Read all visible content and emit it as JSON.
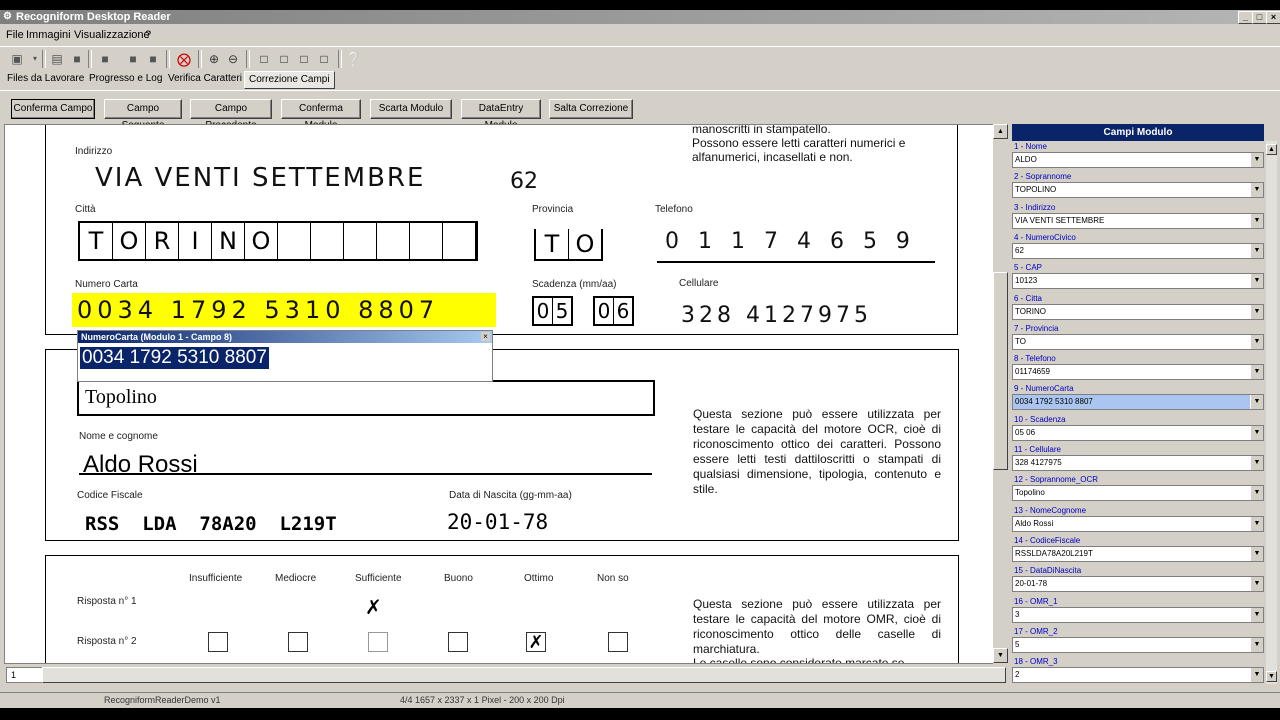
{
  "window": {
    "title": "Recogniform Desktop Reader",
    "buttons": [
      "_",
      "□",
      "×"
    ]
  },
  "menu": [
    "File",
    "Immagini",
    "Visualizzazione",
    "?"
  ],
  "tabs": [
    {
      "label": "Files da Lavorare"
    },
    {
      "label": "Progresso e Log"
    },
    {
      "label": "Verifica Caratteri"
    },
    {
      "label": "Correzione Campi"
    }
  ],
  "actions": [
    "Conferma Campo",
    "Campo Seguente",
    "Campo Precedente",
    "Conferma Modulo",
    "Scarta Modulo",
    "DataEntry Modulo",
    "Salta Correzione"
  ],
  "document": {
    "top_text_line1": "manoscritti in stampatello.",
    "top_text_line2": "Possono essere letti caratteri numerici e",
    "top_text_line3": "alfanumerici, incasellati e non.",
    "label_indirizzo": "Indirizzo",
    "hw_indirizzo": "VIA  VENTI  SETTEMBRE",
    "hw_civico": "62",
    "label_citta": "Città",
    "citta_boxes": [
      "T",
      "O",
      "R",
      "I",
      "N",
      "O",
      "",
      "",
      "",
      "",
      "",
      "",
      ""
    ],
    "label_provincia": "Provincia",
    "provincia_boxes": [
      "T",
      "O"
    ],
    "label_telefono": "Telefono",
    "hw_telefono": "0 1 1 7 4 6 5 9",
    "label_numero_carta": "Numero Carta",
    "hw_numero_carta": "0034  1792  5310  8807",
    "label_scadenza": "Scadenza (mm/aa)",
    "scadenza_boxes": [
      "0",
      "5",
      "0",
      "6"
    ],
    "label_cellulare": "Cellulare",
    "hw_cellulare": "328   4127975",
    "popup_caption": "NumeroCarta (Modulo 1 - Campo 8)",
    "popup_value": "0034 1792 5310 8807",
    "typed_soprannome": "Topolino",
    "label_nome": "Nome e cognome",
    "typed_nome": "Aldo Rossi",
    "label_cf": "Codice Fiscale",
    "typed_cf": "RSS  LDA  78A20  L219T",
    "label_nascita": "Data di Nascita (gg-mm-aa)",
    "typed_nascita": "20-01-78",
    "ocr_text": "Questa sezione può essere utilizzata per testare le capacità del motore OCR, cioè di riconoscimento ottico dei caratteri. Possono essere letti testi dattiloscritti o stampati di qualsiasi dimensione, tipologia, contenuto e stile.",
    "omr_headers": [
      "Insufficiente",
      "Mediocre",
      "Sufficiente",
      "Buono",
      "Ottimo",
      "Non so"
    ],
    "risposta1": "Risposta n° 1",
    "risposta2": "Risposta n° 2",
    "omr_text": "Questa sezione può essere utilizzata per testare le capacità del motore OMR, cioè di riconoscimento ottico delle caselle di marchiatura.",
    "omr_text_cut": "Le caselle sono considerate marcate se"
  },
  "panel": {
    "title": "Campi Modulo",
    "fields": [
      {
        "label": "1 - Nome",
        "value": "ALDO"
      },
      {
        "label": "2 - Soprannome",
        "value": "TOPOLINO"
      },
      {
        "label": "3 - Indirizzo",
        "value": "VIA VENTI SETTEMBRE"
      },
      {
        "label": "4 - NumeroCivico",
        "value": "62"
      },
      {
        "label": "5 - CAP",
        "value": "10123"
      },
      {
        "label": "6 - Citta",
        "value": "TORINO"
      },
      {
        "label": "7 - Provincia",
        "value": "TO"
      },
      {
        "label": "8 - Telefono",
        "value": "01174659"
      },
      {
        "label": "9 - NumeroCarta",
        "value": "0034 1792 5310 8807"
      },
      {
        "label": "10 - Scadenza",
        "value": "05 06"
      },
      {
        "label": "11 - Cellulare",
        "value": "328 4127975"
      },
      {
        "label": "12 - Soprannome_OCR",
        "value": "Topolino"
      },
      {
        "label": "13 - NomeCognome",
        "value": "Aldo Rossi"
      },
      {
        "label": "14 - CodiceFiscale",
        "value": "RSSLDA78A20L219T"
      },
      {
        "label": "15 - DataDiNascita",
        "value": "20-01-78"
      },
      {
        "label": "16 - OMR_1",
        "value": "3"
      },
      {
        "label": "17 - OMR_2",
        "value": "5"
      },
      {
        "label": "18 - OMR_3",
        "value": "2"
      }
    ]
  },
  "status": {
    "page": "1",
    "app": "RecogniformReaderDemo v1",
    "info": "4/4 1657 x 2337 x 1 Pixel - 200 x 200 Dpi"
  },
  "colors": {
    "accent": "#0a246a",
    "highlight": "#ffff00",
    "field_label": "#0000c0"
  }
}
